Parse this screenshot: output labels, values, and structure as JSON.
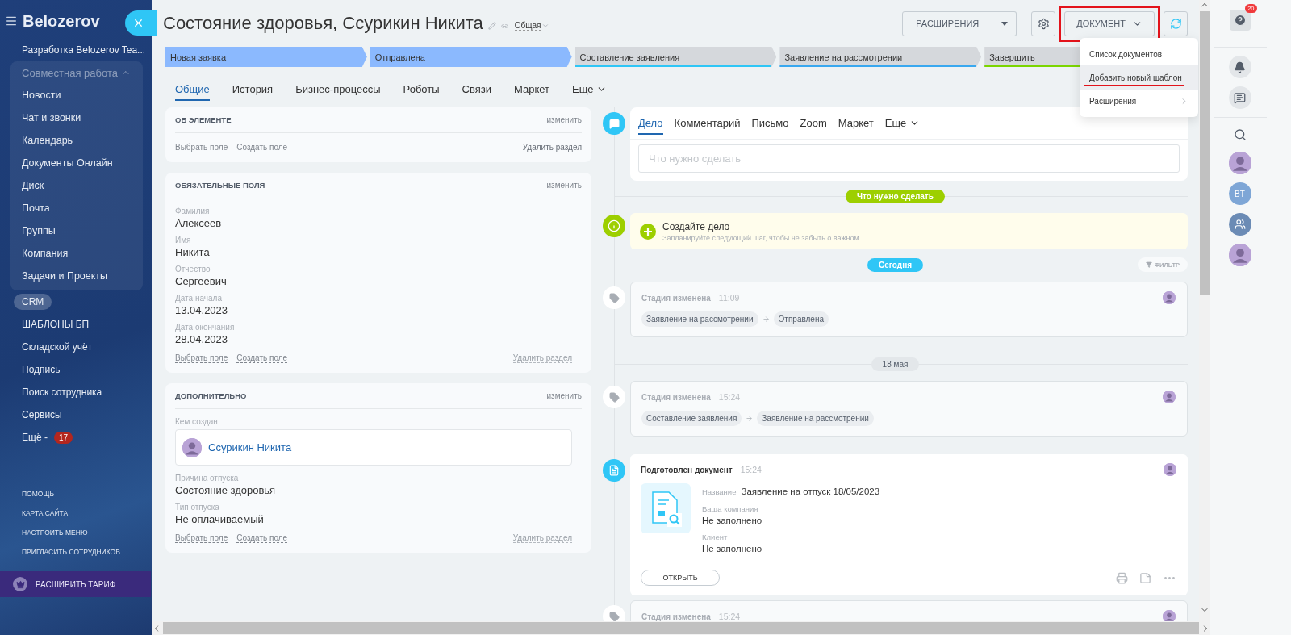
{
  "sidebar": {
    "brand": "Belozerov",
    "items": [
      {
        "kind": "link",
        "label": "Разработка Belozerov Tea...",
        "selected": false
      },
      {
        "kind": "group",
        "label": "Совместная работа",
        "expanded": true,
        "selected": false,
        "children": [
          {
            "label": "Новости"
          },
          {
            "label": "Чат и звонки"
          },
          {
            "label": "Календарь"
          },
          {
            "label": "Документы Онлайн"
          },
          {
            "label": "Диск"
          },
          {
            "label": "Почта"
          },
          {
            "label": "Группы"
          },
          {
            "label": "Компания"
          },
          {
            "label": "Задачи и Проекты"
          }
        ]
      },
      {
        "kind": "link",
        "label": "CRM",
        "selected": true
      },
      {
        "kind": "link",
        "label": "ШАБЛОНЫ БП",
        "selected": false
      },
      {
        "kind": "link",
        "label": "Складской учёт",
        "selected": false
      },
      {
        "kind": "link",
        "label": "Подпись",
        "selected": false
      },
      {
        "kind": "link",
        "label": "Поиск сотрудника",
        "selected": false
      },
      {
        "kind": "link",
        "label": "Сервисы",
        "selected": false
      },
      {
        "kind": "link",
        "label": "Ещё -",
        "selected": false,
        "badge": "17"
      }
    ],
    "footer_links": [
      "ПОМОЩЬ",
      "КАРТА САЙТА",
      "НАСТРОИТЬ МЕНЮ",
      "ПРИГЛАСИТЬ СОТРУДНИКОВ"
    ],
    "upgrade": "РАСШИРИТЬ ТАРИФ"
  },
  "header": {
    "title": "Состояние здоровья, Ссурикин Никита",
    "category": "Общая",
    "extensions_button": "РАСШИРЕНИЯ",
    "document_button": {
      "label": "ДОКУМЕНТ",
      "outlined": true
    }
  },
  "document_menu": [
    {
      "label": "Список документов",
      "hovered": false,
      "underlined": false,
      "submenu": false
    },
    {
      "label": "Добавить новый шаблон",
      "hovered": true,
      "underlined": true,
      "submenu": false
    },
    {
      "label": "Расширения",
      "hovered": false,
      "underlined": false,
      "submenu": true
    }
  ],
  "stages": [
    {
      "label": "Новая заявка",
      "reached": true,
      "color": "#8bb9fe"
    },
    {
      "label": "Отправлена",
      "reached": true,
      "color": "#8bb9fe"
    },
    {
      "label": "Составление заявления",
      "reached": false,
      "color": "#2fc6f6"
    },
    {
      "label": "Заявление на рассмотрении",
      "reached": false,
      "color": "#39a8ef"
    },
    {
      "label": "Завершить",
      "reached": false,
      "color": "#7bd500"
    }
  ],
  "tabs": [
    {
      "label": "Общие",
      "selected": true,
      "has_menu": false
    },
    {
      "label": "История",
      "selected": false,
      "has_menu": false
    },
    {
      "label": "Бизнес-процессы",
      "selected": false,
      "has_menu": false
    },
    {
      "label": "Роботы",
      "selected": false,
      "has_menu": false
    },
    {
      "label": "Связи",
      "selected": false,
      "has_menu": false
    },
    {
      "label": "Маркет",
      "selected": false,
      "has_menu": false
    },
    {
      "label": "Еще",
      "selected": false,
      "has_menu": true
    }
  ],
  "cards": [
    {
      "title": "ОБ ЭЛЕМЕНТЕ",
      "edit": "изменить",
      "actions": [
        "Выбрать поле",
        "Создать поле"
      ],
      "delete": "Удалить раздел",
      "delete_disabled": false
    },
    {
      "title": "ОБЯЗАТЕЛЬНЫЕ ПОЛЯ",
      "edit": "изменить",
      "fields": [
        {
          "kind": "text",
          "label": "Фамилия",
          "value": "Алексеев"
        },
        {
          "kind": "text",
          "label": "Имя",
          "value": "Никита"
        },
        {
          "kind": "text",
          "label": "Отчество",
          "value": "Сергеевич"
        },
        {
          "kind": "text",
          "label": "Дата начала",
          "value": "13.04.2023"
        },
        {
          "kind": "text",
          "label": "Дата окончания",
          "value": "28.04.2023"
        }
      ],
      "actions": [
        "Выбрать поле",
        "Создать поле"
      ],
      "delete": "Удалить раздел",
      "delete_disabled": true
    },
    {
      "title": "ДОПОЛНИТЕЛЬНО",
      "edit": "изменить",
      "fields": [
        {
          "kind": "user",
          "label": "Кем создан",
          "value": "Ссурикин Никита"
        },
        {
          "kind": "text",
          "label": "Причина отпуска",
          "value": "Состояние здоровья"
        },
        {
          "kind": "text",
          "label": "Тип отпуска",
          "value": "Не оплачиваемый"
        }
      ],
      "actions": [
        "Выбрать поле",
        "Создать поле"
      ],
      "delete": "Удалить раздел",
      "delete_disabled": true
    }
  ],
  "composer": {
    "tabs": [
      {
        "label": "Дело",
        "selected": true,
        "has_menu": false
      },
      {
        "label": "Комментарий",
        "selected": false,
        "has_menu": false
      },
      {
        "label": "Письмо",
        "selected": false,
        "has_menu": false
      },
      {
        "label": "Zoom",
        "selected": false,
        "has_menu": false
      },
      {
        "label": "Маркет",
        "selected": false,
        "has_menu": false
      },
      {
        "label": "Еще",
        "selected": false,
        "has_menu": true
      }
    ],
    "placeholder": "Что нужно сделать"
  },
  "todo_label": "Что нужно сделать",
  "create_task": {
    "title": "Создайте дело",
    "hint": "Запланируйте следующий шаг, чтобы не забыть о важном"
  },
  "today_label": "Сегодня",
  "filter": "ФИЛЬТР",
  "events": [
    {
      "kind": "stage",
      "title": "Стадия изменена",
      "time": "11:09",
      "from": "Заявление на рассмотрении",
      "to": "Отправлена"
    },
    {
      "kind": "date",
      "label": "18 мая"
    },
    {
      "kind": "stage",
      "title": "Стадия изменена",
      "time": "15:24",
      "from": "Составление заявления",
      "to": "Заявление на рассмотрении"
    },
    {
      "kind": "document",
      "title": "Подготовлен документ",
      "time": "15:24",
      "name_label": "Название",
      "name": "Заявление на отпуск 18/05/2023",
      "fields": [
        {
          "label": "Ваша компания",
          "value": "Не заполнено"
        },
        {
          "label": "Клиент",
          "value": "Не заполнено"
        }
      ],
      "button": "ОТКРЫТЬ"
    },
    {
      "kind": "stage",
      "title": "Стадия изменена",
      "time": "15:24"
    }
  ],
  "right_bar": {
    "help_badge": "20",
    "user_initials": "BT"
  }
}
